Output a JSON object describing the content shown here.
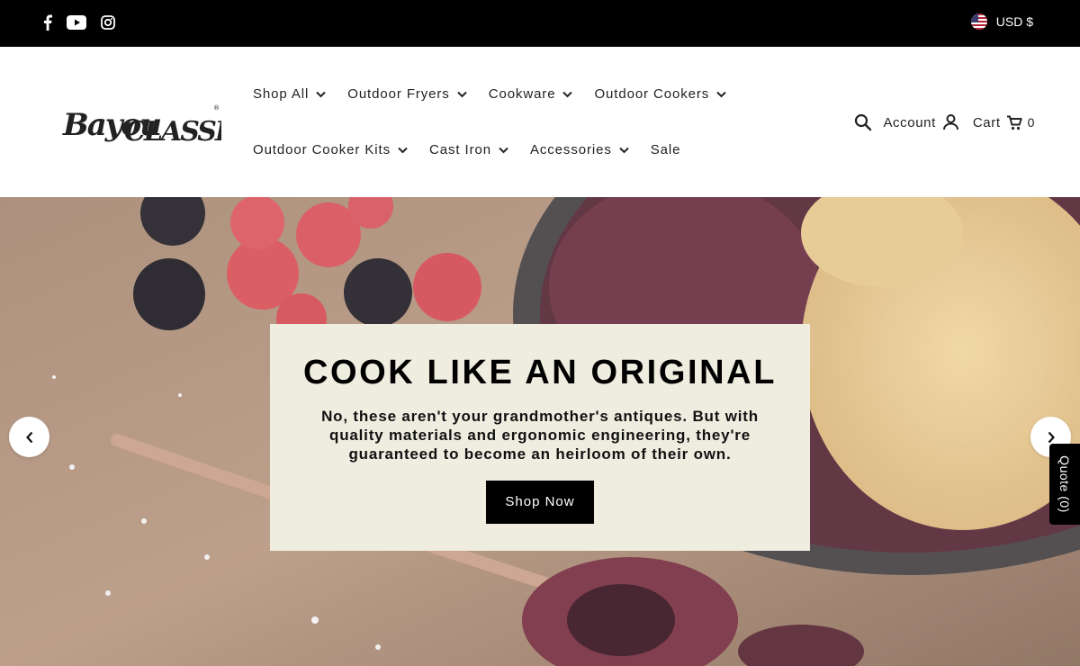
{
  "topbar": {
    "social": [
      "facebook-icon",
      "youtube-icon",
      "instagram-icon"
    ],
    "currency_label": "USD $",
    "currency_flag": "us-flag-icon"
  },
  "header": {
    "logo_text": "BAYOU CLASSIC",
    "nav_row1": [
      {
        "label": "Shop All",
        "dropdown": true
      },
      {
        "label": "Outdoor Fryers",
        "dropdown": true
      },
      {
        "label": "Cookware",
        "dropdown": true
      },
      {
        "label": "Outdoor Cookers",
        "dropdown": true
      }
    ],
    "nav_row2": [
      {
        "label": "Outdoor Cooker Kits",
        "dropdown": true
      },
      {
        "label": "Cast Iron",
        "dropdown": true
      },
      {
        "label": "Accessories",
        "dropdown": true
      },
      {
        "label": "Sale",
        "dropdown": false
      }
    ],
    "account_label": "Account",
    "cart_label": "Cart",
    "cart_count": "0"
  },
  "hero": {
    "title": "COOK LIKE AN ORIGINAL",
    "subtitle": "No, these aren't your grandmother's antiques. But with quality materials and ergonomic engineering, they're guaranteed to become an heirloom of their own.",
    "cta_label": "Shop Now"
  },
  "quote_tab": {
    "label": "Quote (0)"
  },
  "colors": {
    "topbar_bg": "#000000",
    "hero_card_bg": "#efede0",
    "button_bg": "#000000",
    "button_text": "#ffffff"
  }
}
